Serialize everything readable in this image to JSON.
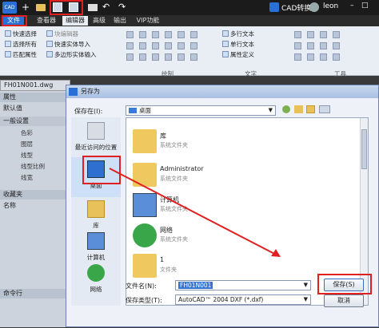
{
  "titlebar": {
    "logo": "CAD",
    "brand": "CAD转换",
    "user": "leon"
  },
  "menubar": {
    "items": [
      "文件",
      "查看器",
      "编辑器",
      "高级",
      "输出",
      "VIP功能"
    ]
  },
  "ribbon": {
    "col1": [
      "快速选择",
      "选择所有",
      "匹配属性"
    ],
    "col2": [
      "块编辑器",
      "快速实体导入",
      "多边形实体输入"
    ],
    "col3": [
      "多行文本",
      "单行文本",
      "属性定义"
    ],
    "groups": [
      "绘制",
      "文字",
      "工具"
    ]
  },
  "doc_tab": "FH01N001.dwg",
  "left_panel": {
    "header": "属性",
    "default": "默认值",
    "general": "一般设置",
    "items": [
      "色彩",
      "图层",
      "线型",
      "线型比例",
      "线宽"
    ],
    "fav": "收藏夹",
    "name": "名称",
    "cmd": "命令行"
  },
  "dialog": {
    "title": "另存为",
    "save_in_label": "保存在(I):",
    "save_in_value": "桌面",
    "places": [
      "最近访问的位置",
      "桌面",
      "库",
      "计算机",
      "网络"
    ],
    "files": [
      {
        "name": "库",
        "type": "系统文件夹",
        "icon": "library-folder-icon"
      },
      {
        "name": "Administrator",
        "type": "系统文件夹",
        "icon": "user-folder-icon"
      },
      {
        "name": "计算机",
        "type": "系统文件夹",
        "icon": "computer-icon"
      },
      {
        "name": "网络",
        "type": "系统文件夹",
        "icon": "network-icon"
      },
      {
        "name": "1",
        "type": "文件夹",
        "icon": "folder-icon"
      }
    ],
    "filename_label": "文件名(N):",
    "filename_value": "FH01N001",
    "filetype_label": "保存类型(T):",
    "filetype_value": "AutoCAD™ 2004 DXF (*.dxf)",
    "save_btn": "保存(S)",
    "cancel_btn": "取消"
  },
  "colors": {
    "accent": "#e02020",
    "ribbon": "#e9eef5"
  }
}
